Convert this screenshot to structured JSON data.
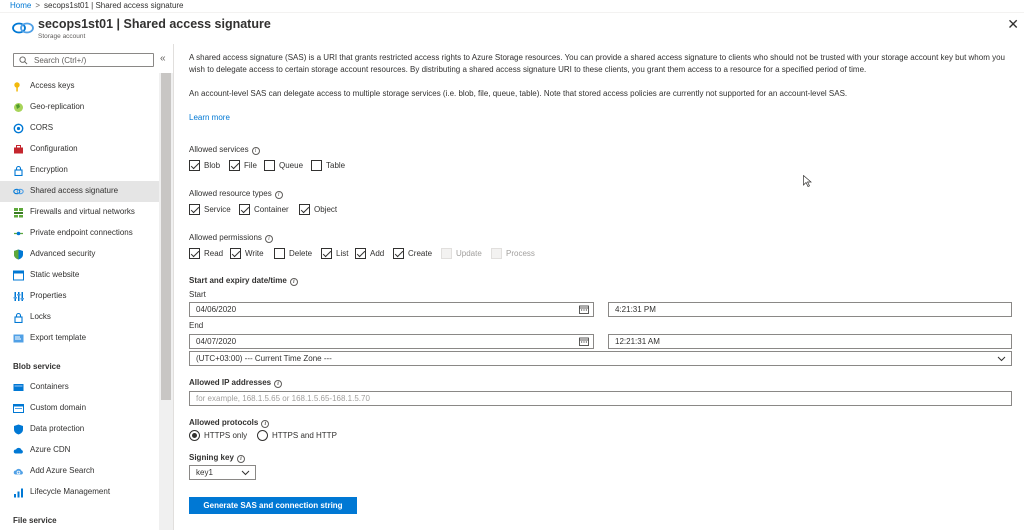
{
  "breadcrumb": {
    "home": "Home",
    "separator": ">",
    "current": "secops1st01 | Shared access signature"
  },
  "header": {
    "title": "secops1st01 | Shared access signature",
    "subtitle": "Storage account",
    "close": "✕"
  },
  "sidebar": {
    "search_placeholder": "Search (Ctrl+/)",
    "collapse": "«",
    "items": [
      {
        "label": "Access keys",
        "icon": "key-icon"
      },
      {
        "label": "Geo-replication",
        "icon": "globe-icon"
      },
      {
        "label": "CORS",
        "icon": "cors-icon"
      },
      {
        "label": "Configuration",
        "icon": "toolbox-icon"
      },
      {
        "label": "Encryption",
        "icon": "lock-icon"
      },
      {
        "label": "Shared access signature",
        "icon": "link-icon",
        "selected": true
      },
      {
        "label": "Firewalls and virtual networks",
        "icon": "firewall-icon"
      },
      {
        "label": "Private endpoint connections",
        "icon": "endpoint-icon"
      },
      {
        "label": "Advanced security",
        "icon": "shield-icon"
      },
      {
        "label": "Static website",
        "icon": "website-icon"
      },
      {
        "label": "Properties",
        "icon": "properties-icon"
      },
      {
        "label": "Locks",
        "icon": "lock-icon"
      },
      {
        "label": "Export template",
        "icon": "export-icon"
      }
    ],
    "blob_heading": "Blob service",
    "blob_items": [
      {
        "label": "Containers",
        "icon": "containers-icon"
      },
      {
        "label": "Custom domain",
        "icon": "domain-icon"
      },
      {
        "label": "Data protection",
        "icon": "shield-icon"
      },
      {
        "label": "Azure CDN",
        "icon": "cloud-icon"
      },
      {
        "label": "Add Azure Search",
        "icon": "search-cloud-icon"
      },
      {
        "label": "Lifecycle Management",
        "icon": "lifecycle-icon"
      }
    ],
    "file_heading": "File service"
  },
  "main": {
    "intro1": "A shared access signature (SAS) is a URI that grants restricted access rights to Azure Storage resources. You can provide a shared access signature to clients who should not be trusted with your storage account key but whom you wish to delegate access to certain storage account resources. By distributing a shared access signature URI to these clients, you grant them access to a resource for a specified period of time.",
    "intro2": "An account-level SAS can delegate access to multiple storage services (i.e. blob, file, queue, table). Note that stored access policies are currently not supported for an account-level SAS.",
    "learn_more": "Learn more",
    "allowed_services": {
      "label": "Allowed services",
      "options": [
        {
          "label": "Blob",
          "checked": true
        },
        {
          "label": "File",
          "checked": true
        },
        {
          "label": "Queue",
          "checked": false
        },
        {
          "label": "Table",
          "checked": false
        }
      ]
    },
    "allowed_resource_types": {
      "label": "Allowed resource types",
      "options": [
        {
          "label": "Service",
          "checked": true
        },
        {
          "label": "Container",
          "checked": true
        },
        {
          "label": "Object",
          "checked": true
        }
      ]
    },
    "allowed_permissions": {
      "label": "Allowed permissions",
      "options": [
        {
          "label": "Read",
          "checked": true
        },
        {
          "label": "Write",
          "checked": true
        },
        {
          "label": "Delete",
          "checked": false
        },
        {
          "label": "List",
          "checked": true
        },
        {
          "label": "Add",
          "checked": true
        },
        {
          "label": "Create",
          "checked": true
        },
        {
          "label": "Update",
          "checked": false,
          "disabled": true
        },
        {
          "label": "Process",
          "checked": false,
          "disabled": true
        }
      ]
    },
    "datetime": {
      "label": "Start and expiry date/time",
      "start_label": "Start",
      "start_date": "04/06/2020",
      "start_time": "4:21:31 PM",
      "end_label": "End",
      "end_date": "04/07/2020",
      "end_time": "12:21:31 AM",
      "timezone": "(UTC+03:00) --- Current Time Zone ---"
    },
    "ip": {
      "label": "Allowed IP addresses",
      "placeholder": "for example, 168.1.5.65 or 168.1.5.65-168.1.5.70"
    },
    "protocols": {
      "label": "Allowed protocols",
      "options": [
        {
          "label": "HTTPS only",
          "selected": true
        },
        {
          "label": "HTTPS and HTTP",
          "selected": false
        }
      ]
    },
    "signing_key": {
      "label": "Signing key",
      "value": "key1"
    },
    "generate_button": "Generate SAS and connection string"
  }
}
